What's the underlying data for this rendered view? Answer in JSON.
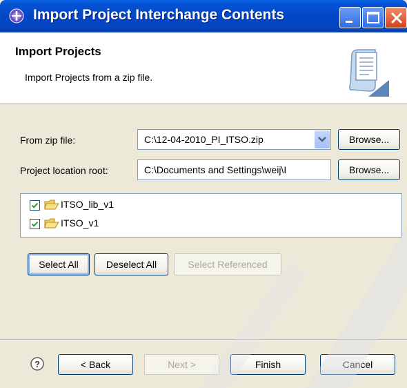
{
  "window": {
    "title": "Import Project Interchange Contents"
  },
  "header": {
    "title": "Import Projects",
    "description": "Import Projects from a zip file."
  },
  "form": {
    "zip_label": "From zip file:",
    "zip_value": "C:\\12-04-2010_PI_ITSO.zip",
    "browse_zip_label": "Browse...",
    "location_label": "Project location root:",
    "location_value": "C:\\Documents and Settings\\weij\\I",
    "browse_location_label": "Browse..."
  },
  "projects": [
    {
      "name": "ITSO_lib_v1",
      "checked": true
    },
    {
      "name": "ITSO_v1",
      "checked": true
    }
  ],
  "selection_buttons": {
    "select_all": "Select All",
    "deselect_all": "Deselect All",
    "select_referenced": "Select Referenced"
  },
  "footer": {
    "back": "< Back",
    "next": "Next >",
    "finish": "Finish",
    "cancel": "Cancel"
  },
  "icons": {
    "title": "import-wizard-icon",
    "header": "import-wizard-banner-icon",
    "help": "help-icon",
    "folder": "folder-icon",
    "combo_arrow": "chevron-down-icon"
  },
  "colors": {
    "titlebar": "#0347c7",
    "dialog_bg": "#ece9d8",
    "header_bg": "#ffffff",
    "button_border": "#003c74",
    "disabled_text": "#aca899"
  }
}
